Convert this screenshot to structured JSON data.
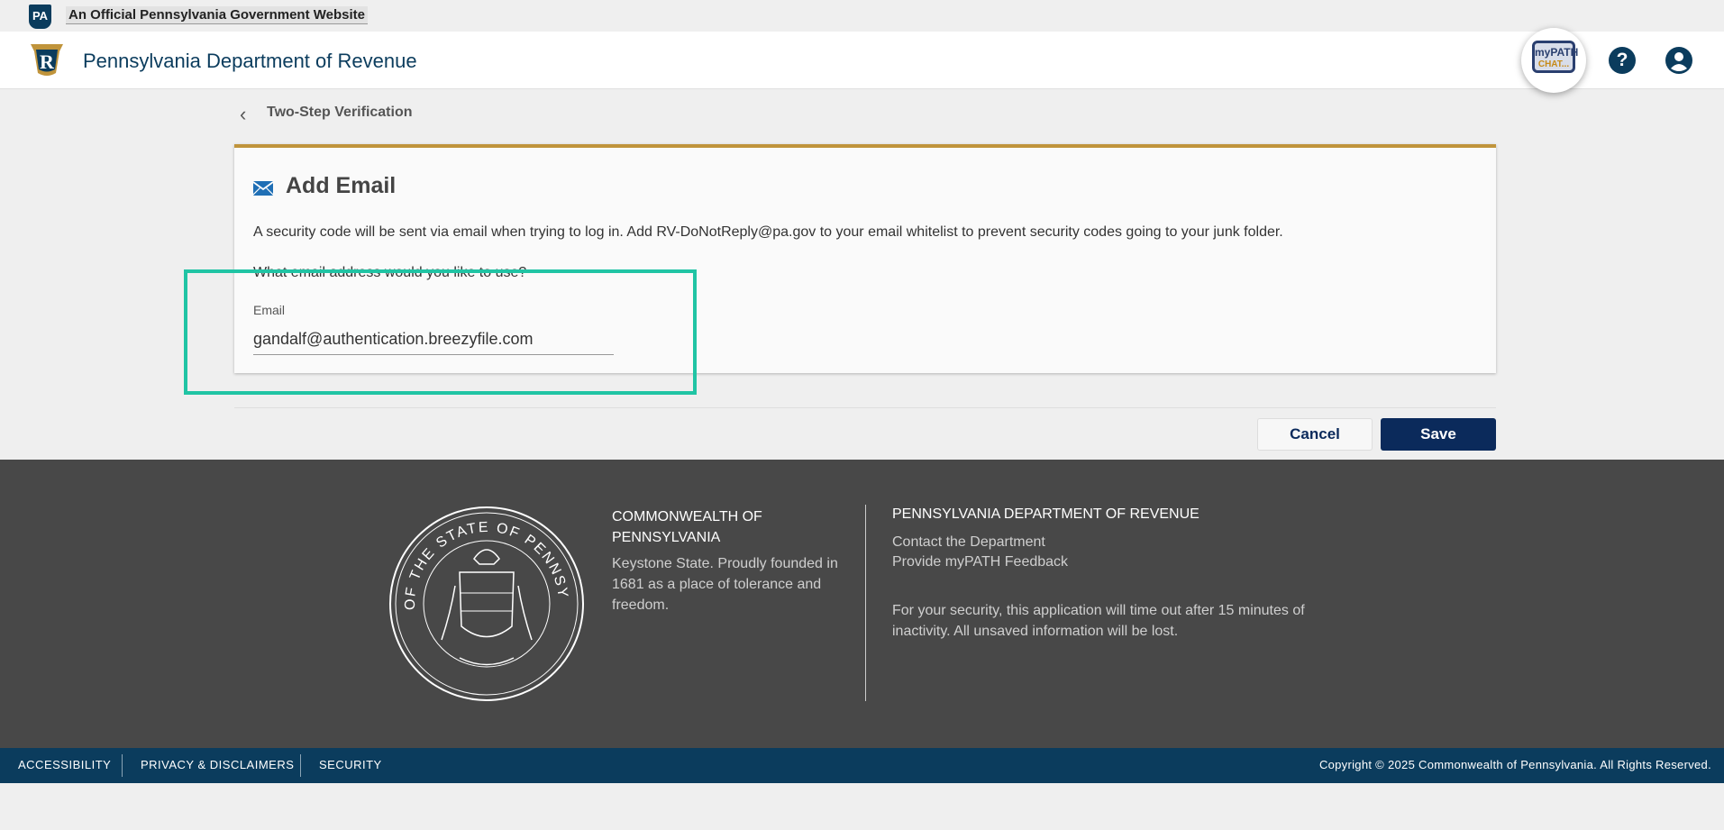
{
  "banner": {
    "badge": "PA",
    "text": "An Official Pennsylvania Government Website"
  },
  "header": {
    "title": "Pennsylvania Department of Revenue",
    "chat_line1": "myPATH",
    "chat_line2": "CHAT...",
    "help_icon": "?"
  },
  "breadcrumb": {
    "label": "Two-Step Verification"
  },
  "card": {
    "title": "Add Email",
    "info": "A security code will be sent via email when trying to log in. Add RV-DoNotReply@pa.gov to your email whitelist to prevent security codes going to your junk folder.",
    "question": "What email address would you like to use?",
    "email_label": "Email",
    "email_value": "gandalf@authentication.breezyfile.com"
  },
  "actions": {
    "cancel": "Cancel",
    "save": "Save"
  },
  "footer": {
    "col1_title": "COMMONWEALTH OF PENNSYLVANIA",
    "col1_text": "Keystone State. Proudly founded in 1681 as a place of tolerance and freedom.",
    "col2_title": "PENNSYLVANIA DEPARTMENT OF REVENUE",
    "links": [
      "Contact the Department",
      "Provide myPATH Feedback"
    ],
    "note": "For your security, this application will time out after 15 minutes of inactivity. All unsaved information will be lost.",
    "seal_text": "SEAL OF THE STATE OF PENNSYLVANIA"
  },
  "bottom_bar": {
    "links": [
      "ACCESSIBILITY",
      "PRIVACY & DISCLAIMERS",
      "SECURITY"
    ],
    "copyright": "Copyright © 2025 Commonwealth of Pennsylvania. All Rights Reserved."
  },
  "colors": {
    "primary": "#0b3c5d",
    "accent": "#c0943b",
    "button": "#0b2a5b",
    "highlight": "#20c4a4"
  }
}
